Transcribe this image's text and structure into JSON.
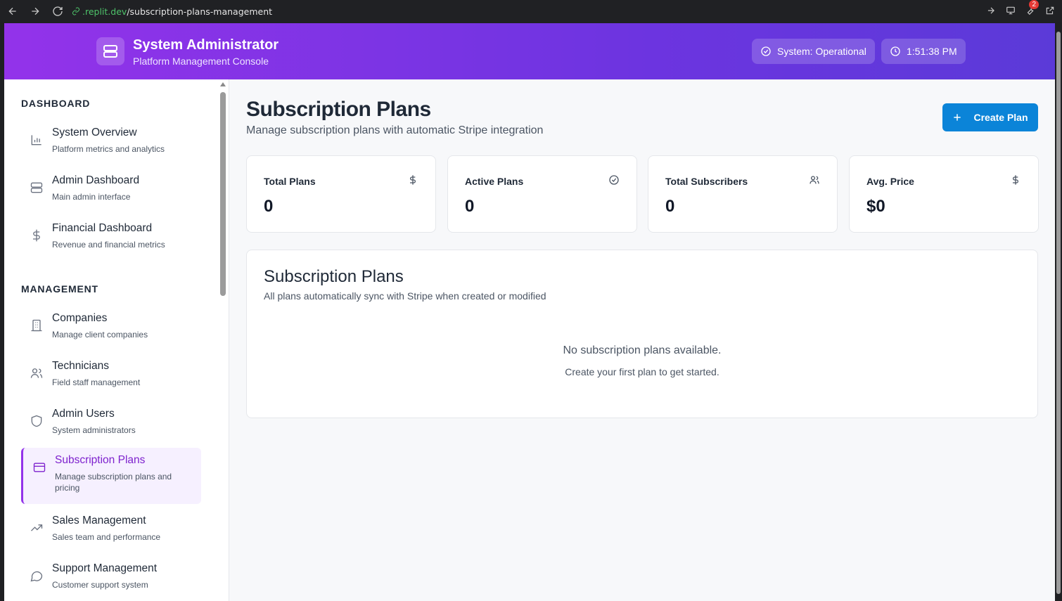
{
  "browser": {
    "url_host": ".replit.dev",
    "url_path": "/subscription-plans-management",
    "notification_count": "2"
  },
  "header": {
    "title": "System Administrator",
    "subtitle": "Platform Management Console",
    "status": "System: Operational",
    "time": "1:51:38 PM"
  },
  "sidebar": {
    "section_dashboard": "DASHBOARD",
    "section_management": "MANAGEMENT",
    "items": [
      {
        "label": "System Overview",
        "desc": "Platform metrics and analytics",
        "icon": "bar-chart-icon"
      },
      {
        "label": "Admin Dashboard",
        "desc": "Main admin interface",
        "icon": "server-icon"
      },
      {
        "label": "Financial Dashboard",
        "desc": "Revenue and financial metrics",
        "icon": "dollar-icon"
      },
      {
        "label": "Companies",
        "desc": "Manage client companies",
        "icon": "building-icon"
      },
      {
        "label": "Technicians",
        "desc": "Field staff management",
        "icon": "users-icon"
      },
      {
        "label": "Admin Users",
        "desc": "System administrators",
        "icon": "shield-icon"
      },
      {
        "label": "Subscription Plans",
        "desc": "Manage subscription plans and pricing",
        "icon": "credit-card-icon",
        "active": true
      },
      {
        "label": "Sales Management",
        "desc": "Sales team and performance",
        "icon": "trending-up-icon"
      },
      {
        "label": "Support Management",
        "desc": "Customer support system",
        "icon": "message-circle-icon"
      }
    ]
  },
  "main": {
    "title": "Subscription Plans",
    "subtitle": "Manage subscription plans with automatic Stripe integration",
    "create_button": "Create Plan",
    "stats": [
      {
        "label": "Total Plans",
        "value": "0",
        "icon": "dollar-icon"
      },
      {
        "label": "Active Plans",
        "value": "0",
        "icon": "check-circle-icon"
      },
      {
        "label": "Total Subscribers",
        "value": "0",
        "icon": "users-icon"
      },
      {
        "label": "Avg. Price",
        "value": "$0",
        "icon": "dollar-icon"
      }
    ],
    "plans": {
      "title": "Subscription Plans",
      "subtitle": "All plans automatically sync with Stripe when created or modified",
      "empty_title": "No subscription plans available.",
      "empty_hint": "Create your first plan to get started."
    }
  },
  "colors": {
    "header_gradient_start": "#9333ea",
    "header_gradient_end": "#5b3ad8",
    "primary_button": "#0b84d8",
    "active_nav": "#7e22ce"
  }
}
